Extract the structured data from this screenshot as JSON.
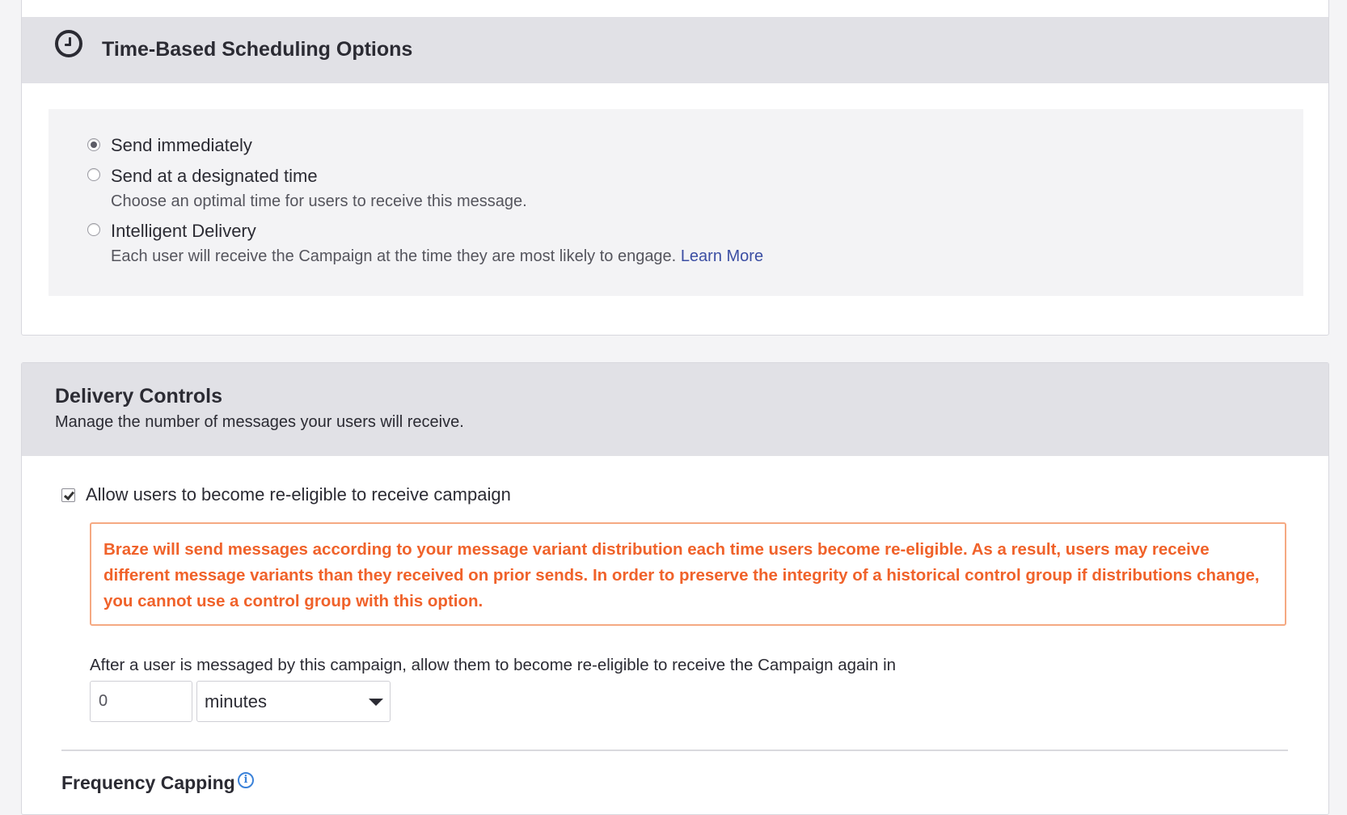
{
  "scheduling": {
    "title": "Time-Based Scheduling Options",
    "icon": "clock-icon",
    "options": [
      {
        "label": "Send immediately",
        "description": "",
        "selected": true
      },
      {
        "label": "Send at a designated time",
        "description": "Choose an optimal time for users to receive this message.",
        "selected": false
      },
      {
        "label": "Intelligent Delivery",
        "description": "Each user will receive the Campaign at the time they are most likely to engage.",
        "selected": false
      }
    ],
    "learn_more": "Learn More"
  },
  "delivery": {
    "title": "Delivery Controls",
    "subtitle": "Manage the number of messages your users will receive.",
    "reeligible_label": "Allow users to become re-eligible to receive campaign",
    "reeligible_checked": true,
    "warning": "Braze will send messages according to your message variant distribution each time users become re-eligible. As a result, users may receive different message variants than they received on prior sends. In order to preserve the integrity of a historical control group if distributions change, you cannot use a control group with this option.",
    "after_text": "After a user is messaged by this campaign, allow them to become re-eligible to receive the Campaign again in",
    "interval_value": "0",
    "interval_unit": "minutes",
    "frequency_capping_title": "Frequency Capping"
  },
  "colors": {
    "warning": "#f0622a",
    "link": "#3b4ea3",
    "info": "#3b82d9"
  }
}
